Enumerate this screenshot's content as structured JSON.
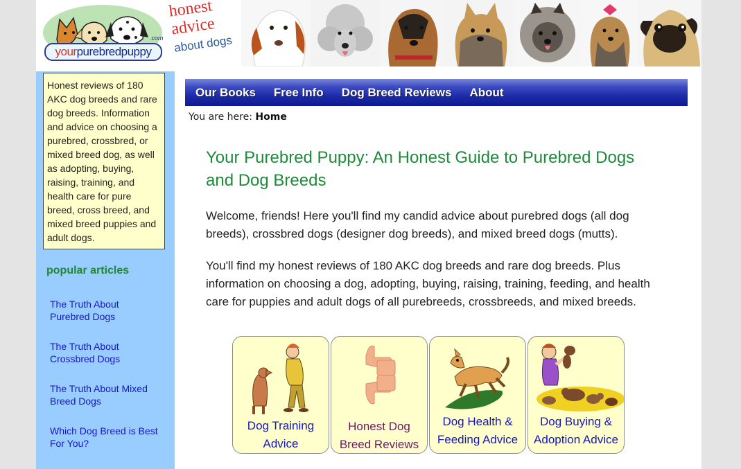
{
  "header": {
    "logo": {
      "prefix": "your",
      "main": "purebredpuppy",
      "suffix": ".com"
    },
    "tagline_line1": "honest advice",
    "tagline_line2": "about dogs"
  },
  "sidebar": {
    "intro": "Honest reviews of 180 AKC dog breeds and rare dog breeds. Information and advice on choosing a purebred, crossbred, or mixed breed dog, as well as adopting, buying, raising, training, and health care for pure breed, cross breed, and mixed breed puppies and adult dogs.",
    "popular_title": "popular articles",
    "links": [
      {
        "label": "The Truth About Purebred Dogs"
      },
      {
        "label": "The Truth About Crossbred Dogs"
      },
      {
        "label": "The Truth About Mixed Breed Dogs"
      },
      {
        "label": "Which Dog Breed is Best For You?"
      }
    ]
  },
  "nav": {
    "items": [
      {
        "label": "Our Books"
      },
      {
        "label": "Free Info"
      },
      {
        "label": "Dog Breed Reviews"
      },
      {
        "label": "About"
      }
    ]
  },
  "breadcrumb": {
    "prefix": "You are here:",
    "current": "Home"
  },
  "main": {
    "title": "Your Purebred Puppy: An Honest Guide to Purebred Dogs and Dog Breeds",
    "paragraphs": [
      "Welcome, friends! Here you'll find my candid advice about purebred dogs (all dog breeds), crossbred dogs (designer dog breeds), and mixed breed dogs (mutts).",
      "You'll find my honest reviews of 180 AKC dog breeds and rare dog breeds. Plus information on choosing a dog, adopting, buying, raising, training, feeding, and health care for puppies and adult dogs of all purebreeds, crossbreeds, and mixed breeds."
    ],
    "cards": [
      {
        "label": "Dog Training Advice",
        "line1": "Dog Training",
        "line2": "Advice",
        "icon": "dog-training-icon"
      },
      {
        "label": "Honest Dog Breed Reviews",
        "line1": "Honest Dog",
        "line2": "Breed Reviews",
        "icon": "thumbs-up-down-icon",
        "color": "#6a1a6a"
      },
      {
        "label": "Dog Health & Feeding Advice",
        "line1": "Dog Health &",
        "line2": "Feeding Advice",
        "icon": "running-dog-icon"
      },
      {
        "label": "Dog Buying & Adoption Advice",
        "line1": "Dog Buying &",
        "line2": "Adoption Advice",
        "icon": "boy-with-puppies-icon"
      }
    ]
  },
  "colors": {
    "sidebar_bg": "#99ccff",
    "intro_bg": "#ffffcc",
    "title_green": "#1e8a3a",
    "link_blue": "#1515c8",
    "nav_blue": "#1c2aa8",
    "visited_purple": "#6a1a6a"
  }
}
